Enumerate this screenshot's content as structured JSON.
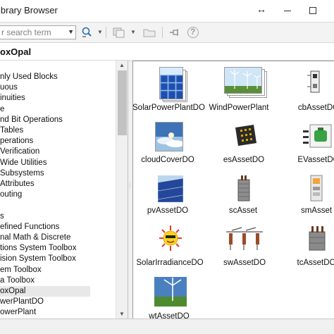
{
  "window": {
    "title": "ibrary Browser",
    "resize_glyph": "↔",
    "controls": [
      "minimize",
      "maximize"
    ]
  },
  "toolbar": {
    "search_placeholder": "r search term",
    "icons": [
      "search-options-icon",
      "find-block-icon",
      "new-library-icon",
      "open-folder-icon",
      "pin-icon",
      "help-icon"
    ],
    "help_glyph": "?"
  },
  "subheader": {
    "title": "oxOpal"
  },
  "tree": {
    "items": [
      {
        "label": "nly Used Blocks"
      },
      {
        "label": "uous"
      },
      {
        "label": "inuities"
      },
      {
        "label": "e"
      },
      {
        "label": "nd Bit Operations"
      },
      {
        "label": "Tables"
      },
      {
        "label": "perations"
      },
      {
        "label": "Verification"
      },
      {
        "label": "Wide Utilities"
      },
      {
        "label": "Subsystems"
      },
      {
        "label": "Attributes"
      },
      {
        "label": "outing"
      },
      {
        "label": ""
      },
      {
        "label": "s"
      },
      {
        "label": "efined Functions"
      },
      {
        "label": "nal Math & Discrete"
      },
      {
        "label": "tions System Toolbox"
      },
      {
        "label": "ision System Toolbox"
      },
      {
        "label": "em Toolbox"
      },
      {
        "label": "a Toolbox"
      },
      {
        "label": "oxOpal"
      },
      {
        "label": "werPlantDO"
      },
      {
        "label": "owerPlant"
      }
    ],
    "selected_index": 20
  },
  "blocks": [
    {
      "label": "SolarPowerPlantDO",
      "icon": "solar-panels"
    },
    {
      "label": "WindPowerPlant",
      "icon": "wind-farm"
    },
    {
      "label": "cbAssetDO",
      "icon": "circuit-breaker"
    },
    {
      "label": "cloudCoverDO",
      "icon": "cloud-sky"
    },
    {
      "label": "esAssetDO",
      "icon": "battery-storage"
    },
    {
      "label": "EVassetDO",
      "icon": "ev-charger"
    },
    {
      "label": "pvAssetDO",
      "icon": "pv-array"
    },
    {
      "label": "scAsset",
      "icon": "capacitor"
    },
    {
      "label": "smAsset",
      "icon": "smart-meter"
    },
    {
      "label": "SolarIrradianceDO",
      "icon": "sun"
    },
    {
      "label": "swAssetDO",
      "icon": "switchgear"
    },
    {
      "label": "tcAssetDO",
      "icon": "transformer"
    },
    {
      "label": "wtAssetDO",
      "icon": "wind-turbine"
    }
  ]
}
